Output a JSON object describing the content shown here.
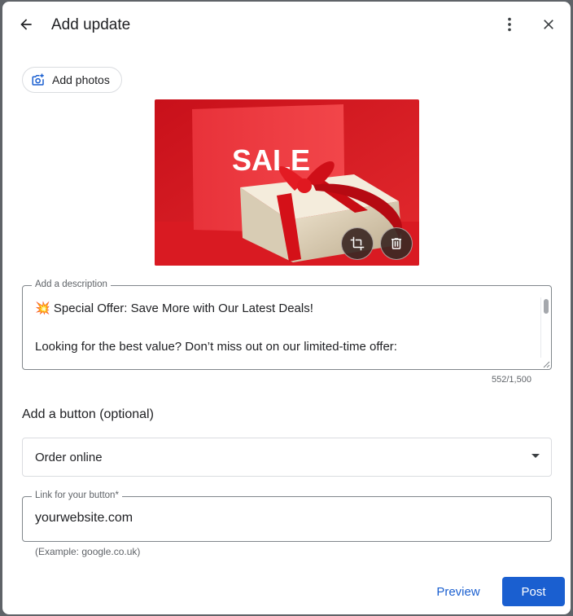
{
  "dialog": {
    "title": "Add update",
    "back_icon": "arrow-back-icon",
    "more_icon": "more-vert-icon",
    "close_icon": "close-icon"
  },
  "photos": {
    "add_label": "Add photos",
    "add_icon": "add-photo-icon",
    "image_text": "SALE",
    "crop_icon": "crop-icon",
    "delete_icon": "trash-icon"
  },
  "description": {
    "label": "Add a description",
    "line1": "💥 Special Offer: Save More with Our Latest Deals!",
    "line2": "Looking for the best value? Don’t miss out on our limited-time offer:",
    "char_count": "552/1,500"
  },
  "button_section": {
    "label": "Add a button (optional)",
    "selected_option": "Order online",
    "link_label": "Link for your button*",
    "link_value": "yourwebsite.com",
    "hint": "(Example: google.co.uk)"
  },
  "actions": {
    "preview_label": "Preview",
    "post_label": "Post"
  },
  "colors": {
    "primary": "#1a5fd0",
    "image_background": "#d8161f"
  }
}
